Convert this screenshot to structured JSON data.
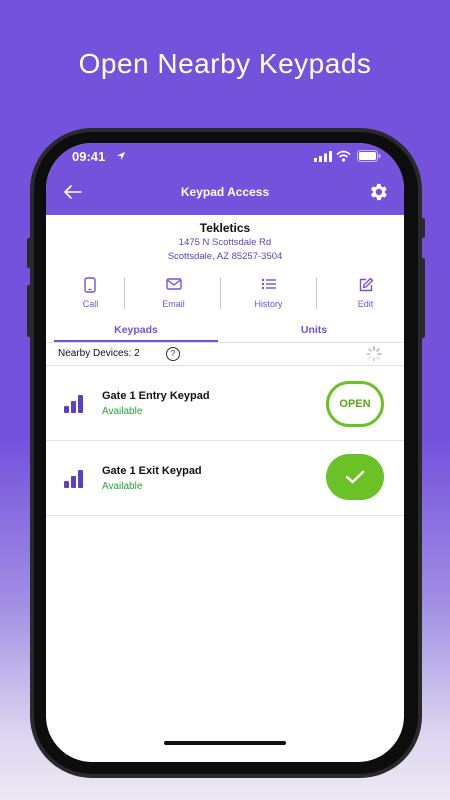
{
  "headline": "Open Nearby Keypads",
  "status_bar": {
    "time": "09:41"
  },
  "app_bar": {
    "title": "Keypad Access",
    "back_icon": "arrow-left-icon",
    "settings_icon": "gear-icon"
  },
  "company": {
    "name": "Tekletics",
    "address_line1": "1475 N Scottsdale Rd",
    "address_line2": "Scottsdale, AZ 85257-3504"
  },
  "actions": [
    {
      "label": "Call",
      "icon": "phone-icon"
    },
    {
      "label": "Email",
      "icon": "mail-icon"
    },
    {
      "label": "History",
      "icon": "list-icon"
    },
    {
      "label": "Edit",
      "icon": "edit-icon"
    }
  ],
  "tabs": [
    {
      "label": "Keypads"
    },
    {
      "label": "Units"
    }
  ],
  "nearby": {
    "label": "Nearby Devices: 2",
    "help": "?"
  },
  "keypads": [
    {
      "name": "Gate 1 Entry Keypad",
      "status": "Available",
      "action": "OPEN"
    },
    {
      "name": "Gate 1 Exit Keypad",
      "status": "Available",
      "action": ""
    }
  ],
  "colors": {
    "primary": "#7452dc",
    "success": "#6cc127",
    "available": "#2aa13a"
  }
}
